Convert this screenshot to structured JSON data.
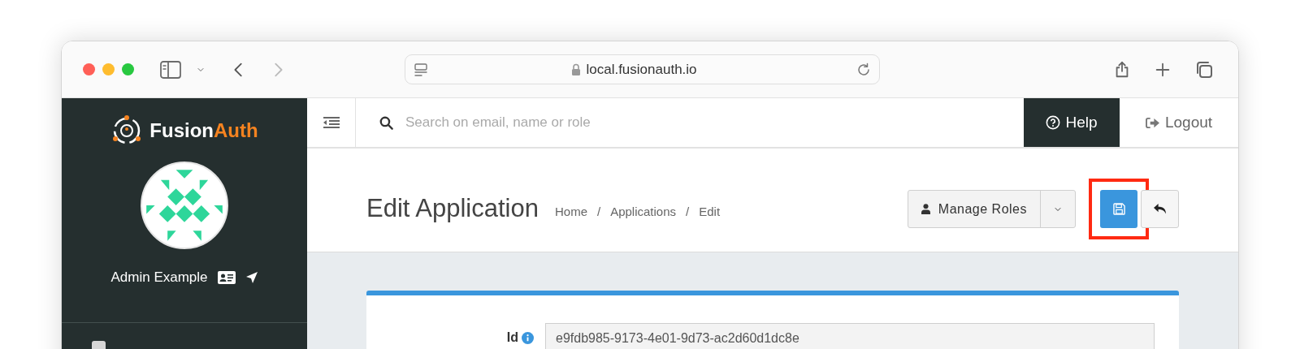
{
  "browser": {
    "url": "local.fusionauth.io"
  },
  "sidebar": {
    "logo": {
      "part_1": "Fusion",
      "part_2": "Auth"
    },
    "user_name": "Admin Example"
  },
  "topbar": {
    "search": {
      "placeholder": "Search on email, name or role"
    },
    "help": "Help",
    "logout": "Logout"
  },
  "header": {
    "title": "Edit Application",
    "breadcrumb_separator": "/",
    "breadcrumbs": [
      {
        "label": "Home"
      },
      {
        "label": "Applications"
      },
      {
        "label": "Edit"
      }
    ],
    "manage_roles": "Manage Roles",
    "save_button": {
      "highlighted": true
    }
  },
  "form": {
    "fields": [
      {
        "label": "Id",
        "value": "e9fdb985-9173-4e01-9d73-ac2d60d1dc8e"
      }
    ]
  }
}
